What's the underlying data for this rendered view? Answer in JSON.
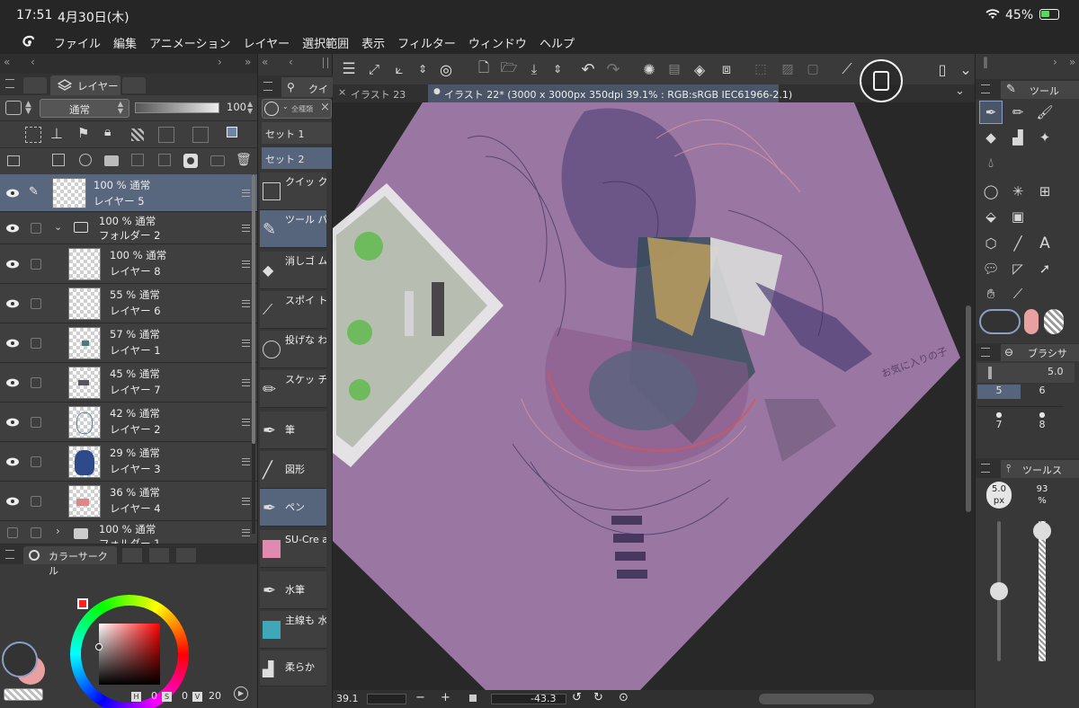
{
  "status": {
    "time": "17:51",
    "date": "4月30日(木)",
    "battery": "45%"
  },
  "menu": [
    "ファイル",
    "編集",
    "アニメーション",
    "レイヤー",
    "選択範囲",
    "表示",
    "フィルター",
    "ウィンドウ",
    "ヘルプ"
  ],
  "layer_panel": {
    "tabs": [
      "レイヤー"
    ],
    "blend_mode": "通常",
    "opacity_value": "100",
    "layers": [
      {
        "line1": "100 % 通常",
        "line2": "レイヤー 5",
        "selected": true
      },
      {
        "line1": "100 % 通常",
        "line2": "フォルダー 2",
        "folder": true,
        "open": true
      },
      {
        "line1": "100 % 通常",
        "line2": "レイヤー 8"
      },
      {
        "line1": "55 % 通常",
        "line2": "レイヤー 6"
      },
      {
        "line1": "57 % 通常",
        "line2": "レイヤー 1"
      },
      {
        "line1": "45 % 通常",
        "line2": "レイヤー 7"
      },
      {
        "line1": "42 % 通常",
        "line2": "レイヤー 2"
      },
      {
        "line1": "29 % 通常",
        "line2": "レイヤー 3"
      },
      {
        "line1": "36 % 通常",
        "line2": "レイヤー 4"
      },
      {
        "line1": "100 % 通常",
        "line2": "フォルダー 1",
        "folder": true,
        "open": false
      }
    ]
  },
  "color_panel": {
    "tab": "カラーサークル",
    "h_label": "H",
    "h": "0",
    "s_label": "S",
    "s": "0",
    "v_label": "V",
    "v": "20",
    "main_color": "#333333",
    "sub_color": "#e8a0a0"
  },
  "quick_panel": {
    "tab": "クイ",
    "search_placeholder": "全種類",
    "sets": [
      "セット 1",
      "セット 2"
    ],
    "items": [
      {
        "label": "クイッ クアクセス"
      },
      {
        "label": "ツール パレットを",
        "selected": true
      },
      {
        "label": "消しゴ ム"
      },
      {
        "label": "スポイ ト"
      },
      {
        "label": "投げな わ塗り"
      },
      {
        "label": "スケッ チ"
      },
      {
        "label": "筆"
      },
      {
        "label": "図形"
      },
      {
        "label": "ペン",
        "selected": true
      },
      {
        "label": "SU-Cre am Pencil"
      },
      {
        "label": "水筆"
      },
      {
        "label": "主線も 水彩も厚塗"
      },
      {
        "label": "柔らか"
      }
    ]
  },
  "canvas": {
    "tabs": [
      {
        "label": "イラスト 23",
        "active": false
      },
      {
        "label": "イラスト 22* (3000 x 3000px 350dpi 39.1% : RGB:sRGB IEC61966-2.1)",
        "active": true
      }
    ],
    "zoom": "39.1",
    "rotation": "-43.3",
    "signature": "お気に入りの子"
  },
  "tool_panel": {
    "title": "ツール"
  },
  "brush_size_panel": {
    "title": "ブラシサ",
    "value": "5.0",
    "sizes": [
      "5",
      "6",
      "7",
      "8"
    ]
  },
  "tool_property": {
    "title": "ツールス",
    "size_value": "5.0",
    "size_unit": "px",
    "opacity_value": "93",
    "opacity_unit": "%",
    "size_level": 0.5,
    "opacity_level": 0.93
  },
  "colors": {
    "accent": "#6f86a8",
    "canvas_purple": "#9a77a3",
    "bg": "#3b3b3b"
  }
}
